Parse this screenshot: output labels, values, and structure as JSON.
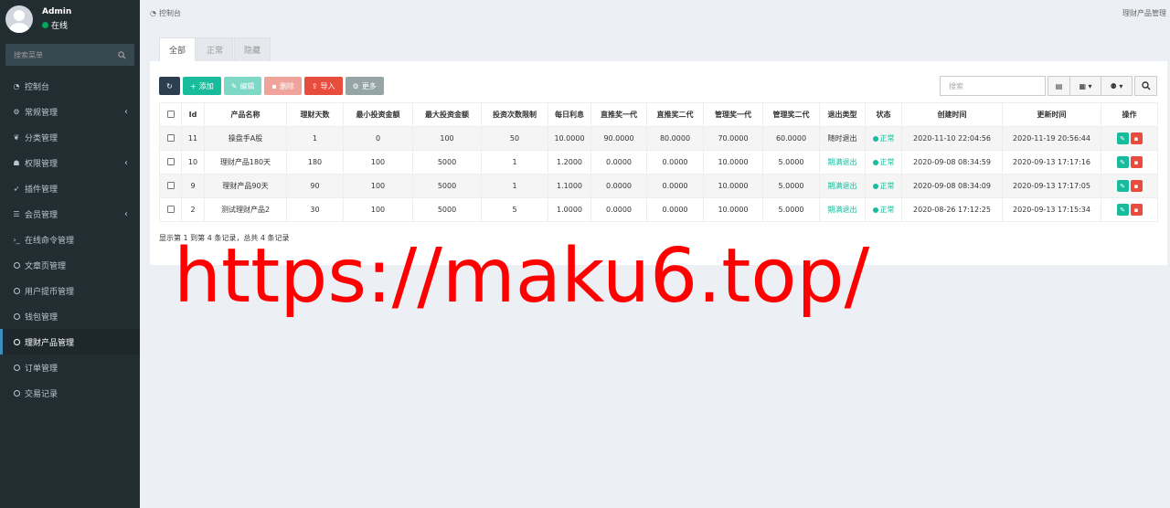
{
  "user": {
    "name": "Admin",
    "status": "在线"
  },
  "sidebar": {
    "search_placeholder": "搜索菜单",
    "items": [
      {
        "label": "控制台",
        "icon": "dashboard-icon",
        "has_children": false
      },
      {
        "label": "常规管理",
        "icon": "cogs-icon",
        "has_children": true
      },
      {
        "label": "分类管理",
        "icon": "leaf-icon",
        "has_children": false
      },
      {
        "label": "权限管理",
        "icon": "group-icon",
        "has_children": true
      },
      {
        "label": "插件管理",
        "icon": "rocket-icon",
        "has_children": false
      },
      {
        "label": "会员管理",
        "icon": "list-icon",
        "has_children": true
      },
      {
        "label": "在线命令管理",
        "icon": "terminal-icon",
        "has_children": false
      },
      {
        "label": "文章页管理",
        "icon": "circle-icon",
        "has_children": false
      },
      {
        "label": "用户提币管理",
        "icon": "circle-icon",
        "has_children": false
      },
      {
        "label": "钱包管理",
        "icon": "circle-icon",
        "has_children": false
      },
      {
        "label": "理财产品管理",
        "icon": "circle-icon",
        "has_children": false,
        "active": true
      },
      {
        "label": "订单管理",
        "icon": "circle-icon",
        "has_children": false
      },
      {
        "label": "交易记录",
        "icon": "circle-icon",
        "has_children": false
      }
    ]
  },
  "breadcrumb": {
    "left": "控制台",
    "right": "理财产品管理"
  },
  "tabs": [
    "全部",
    "正常",
    "隐藏"
  ],
  "toolbar": {
    "add": "添加",
    "edit": "编辑",
    "delete": "删除",
    "import": "导入",
    "more": "更多"
  },
  "search": {
    "placeholder": "搜索"
  },
  "table": {
    "columns": [
      "Id",
      "产品名称",
      "理财天数",
      "最小投资金额",
      "最大投资金额",
      "投资次数限制",
      "每日利息",
      "直推奖一代",
      "直推奖二代",
      "管理奖一代",
      "管理奖二代",
      "退出类型",
      "状态",
      "创建时间",
      "更新时间",
      "操作"
    ],
    "rows": [
      [
        "11",
        "操盘手A股",
        "1",
        "0",
        "100",
        "50",
        "10.0000",
        "90.0000",
        "80.0000",
        "70.0000",
        "60.0000",
        "随时退出",
        "正常",
        "2020-11-10 22:04:56",
        "2020-11-19 20:56:44"
      ],
      [
        "10",
        "理财产品180天",
        "180",
        "100",
        "5000",
        "1",
        "1.2000",
        "0.0000",
        "0.0000",
        "10.0000",
        "5.0000",
        "期满退出",
        "正常",
        "2020-09-08 08:34:59",
        "2020-09-13 17:17:16"
      ],
      [
        "9",
        "理财产品90天",
        "90",
        "100",
        "5000",
        "1",
        "1.1000",
        "0.0000",
        "0.0000",
        "10.0000",
        "5.0000",
        "期满退出",
        "正常",
        "2020-09-08 08:34:09",
        "2020-09-13 17:17:05"
      ],
      [
        "2",
        "测试理财产品2",
        "30",
        "100",
        "5000",
        "5",
        "1.0000",
        "0.0000",
        "0.0000",
        "10.0000",
        "5.0000",
        "期满退出",
        "正常",
        "2020-08-26 17:12:25",
        "2020-09-13 17:15:34"
      ]
    ]
  },
  "footer_note": "显示第 1 到第 4 条记录，总共 4 条记录",
  "watermark": "https://maku6.top/",
  "colors": {
    "sidebar": "#222d32",
    "accent": "#18bc9c",
    "danger": "#e74c3c",
    "watermark": "#ff0000"
  }
}
